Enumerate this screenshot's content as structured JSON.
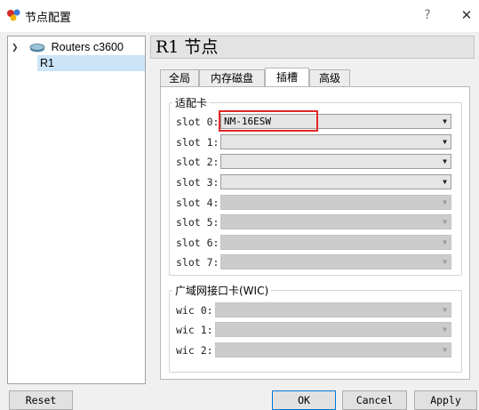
{
  "window": {
    "title": "节点配置",
    "help": "?",
    "close": "✕"
  },
  "tree": {
    "root_label": "Routers c3600",
    "child_label": "R1"
  },
  "header": {
    "title": "R1 节点"
  },
  "tabs": [
    {
      "label": "全局"
    },
    {
      "label": "内存磁盘"
    },
    {
      "label": "插槽"
    },
    {
      "label": "高级"
    }
  ],
  "adapters": {
    "title": "适配卡",
    "slots": [
      {
        "label": "slot 0:",
        "value": "NM-16ESW"
      },
      {
        "label": "slot 1:",
        "value": ""
      },
      {
        "label": "slot 2:",
        "value": ""
      },
      {
        "label": "slot 3:",
        "value": ""
      },
      {
        "label": "slot 4:",
        "value": ""
      },
      {
        "label": "slot 5:",
        "value": ""
      },
      {
        "label": "slot 6:",
        "value": ""
      },
      {
        "label": "slot 7:",
        "value": ""
      }
    ]
  },
  "wics": {
    "title": "广域网接口卡(WIC)",
    "slots": [
      {
        "label": "wic 0:",
        "value": ""
      },
      {
        "label": "wic 1:",
        "value": ""
      },
      {
        "label": "wic 2:",
        "value": ""
      }
    ]
  },
  "buttons": {
    "reset": "Reset",
    "ok": "OK",
    "cancel": "Cancel",
    "apply": "Apply"
  }
}
